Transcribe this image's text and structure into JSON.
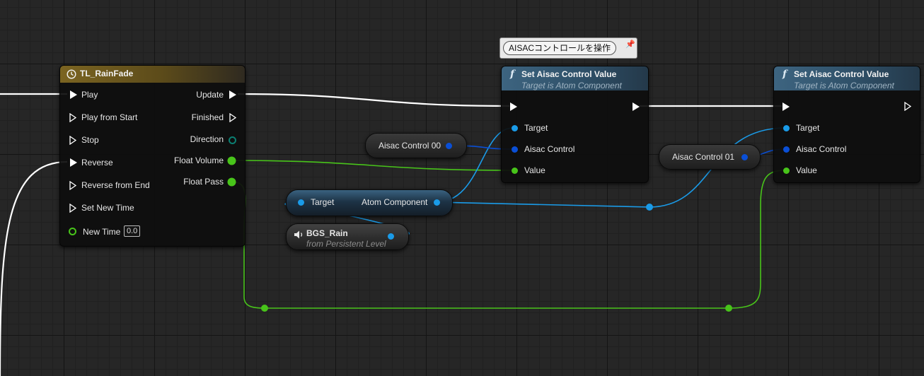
{
  "timeline_node": {
    "title": "TL_RainFade",
    "icon": "clock-icon",
    "inputs": [
      "Play",
      "Play from Start",
      "Stop",
      "Reverse",
      "Reverse from End",
      "Set New Time",
      "New Time"
    ],
    "new_time_value": "0.0",
    "outputs": [
      "Update",
      "Finished",
      "Direction",
      "Float Volume",
      "Float Pass"
    ]
  },
  "comment_bubble": {
    "text": "AISACコントロールを操作"
  },
  "set_aisac_1": {
    "title": "Set Aisac Control Value",
    "subtitle": "Target is Atom Component",
    "pins": [
      "Target",
      "Aisac Control",
      "Value"
    ]
  },
  "set_aisac_2": {
    "title": "Set Aisac Control Value",
    "subtitle": "Target is Atom Component",
    "pins": [
      "Target",
      "Aisac Control",
      "Value"
    ]
  },
  "aisac_control_00": {
    "label": "Aisac Control 00"
  },
  "aisac_control_01": {
    "label": "Aisac Control 01"
  },
  "atom_component_node": {
    "input_label": "Target",
    "output_label": "Atom Component"
  },
  "bgs_rain_node": {
    "title": "BGS_Rain",
    "subtitle": "from Persistent Level",
    "icon": "speaker-icon"
  },
  "colors": {
    "exec_wire": "#ffffff",
    "object_wire": "#1a9be8",
    "struct_wire": "#0a4fd6",
    "float_wire": "#48c41a",
    "timeline_header": "#7b6421",
    "function_header": "#3d6480"
  }
}
